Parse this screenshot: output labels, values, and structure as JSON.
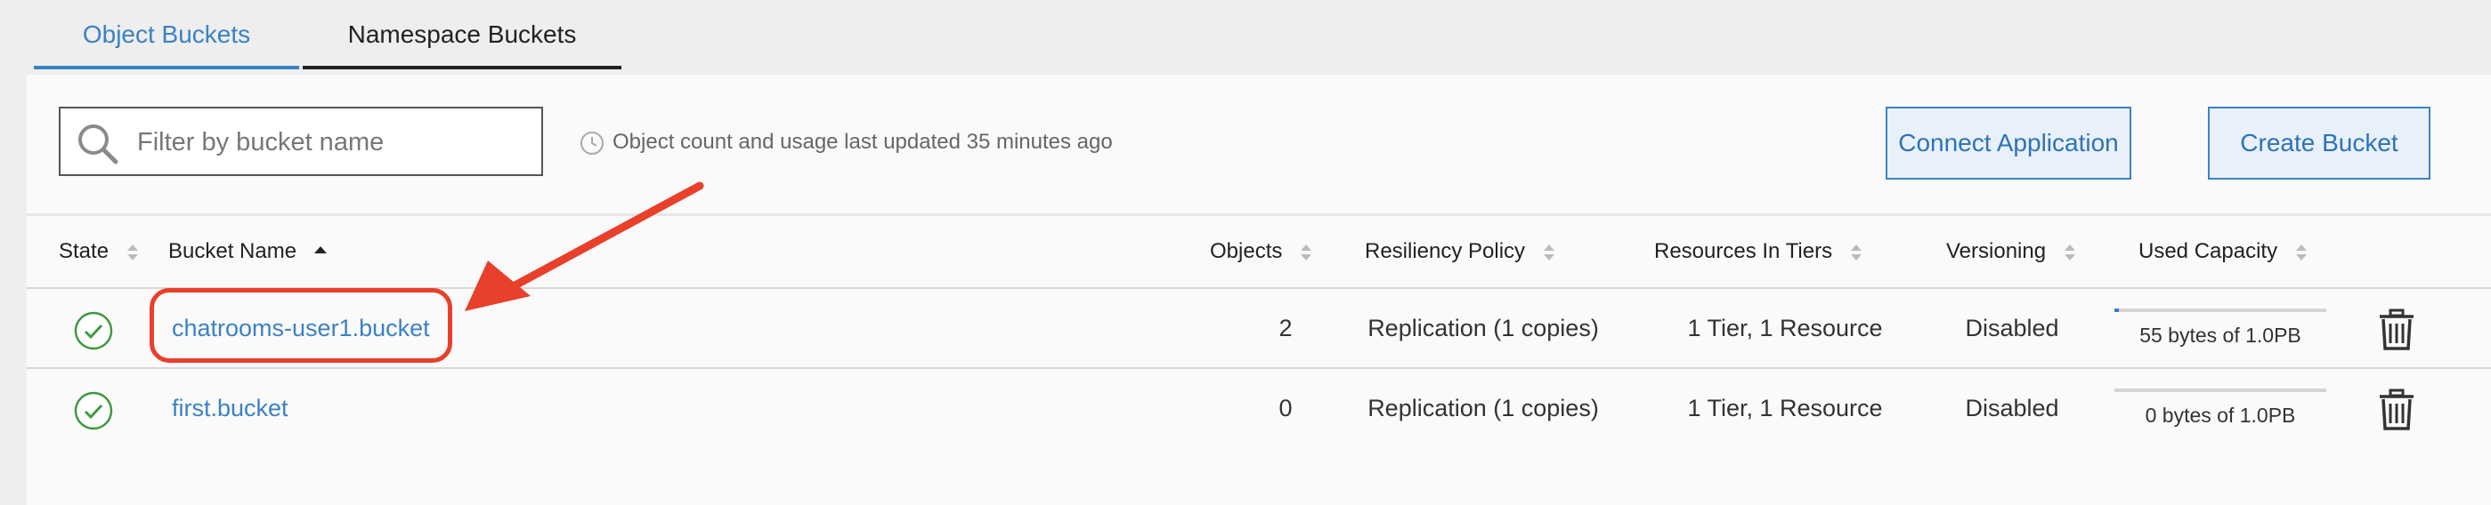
{
  "tabs": [
    {
      "label": "Object Buckets",
      "active": true
    },
    {
      "label": "Namespace Buckets",
      "active": false
    }
  ],
  "toolbar": {
    "search_placeholder": "Filter by bucket name",
    "search_value": "",
    "updated_text": "Object count and usage last updated 35 minutes ago",
    "connect_label": "Connect Application",
    "create_label": "Create Bucket"
  },
  "table": {
    "columns": [
      "State",
      "Bucket Name",
      "Objects",
      "Resiliency Policy",
      "Resources In Tiers",
      "Versioning",
      "Used Capacity"
    ],
    "sorted_column": "Bucket Name",
    "rows": [
      {
        "state": "healthy",
        "name": "chatrooms-user1.bucket",
        "objects": "2",
        "policy": "Replication (1 copies)",
        "tiers": "1 Tier, 1 Resource",
        "versioning": "Disabled",
        "capacity": "55 bytes of 1.0PB",
        "capacity_fraction": 0.02
      },
      {
        "state": "healthy",
        "name": "first.bucket",
        "objects": "0",
        "policy": "Replication (1 copies)",
        "tiers": "1 Tier, 1 Resource",
        "versioning": "Disabled",
        "capacity": "0 bytes of 1.0PB",
        "capacity_fraction": 0
      }
    ]
  },
  "icons": {
    "search": "search-icon",
    "clock": "clock-icon",
    "state": "check-circle-icon",
    "sort": "sort-icon",
    "delete": "trash-icon"
  },
  "colors": {
    "accent": "#3b82c4",
    "success": "#3e9a3e",
    "annotation": "#e8402a"
  }
}
